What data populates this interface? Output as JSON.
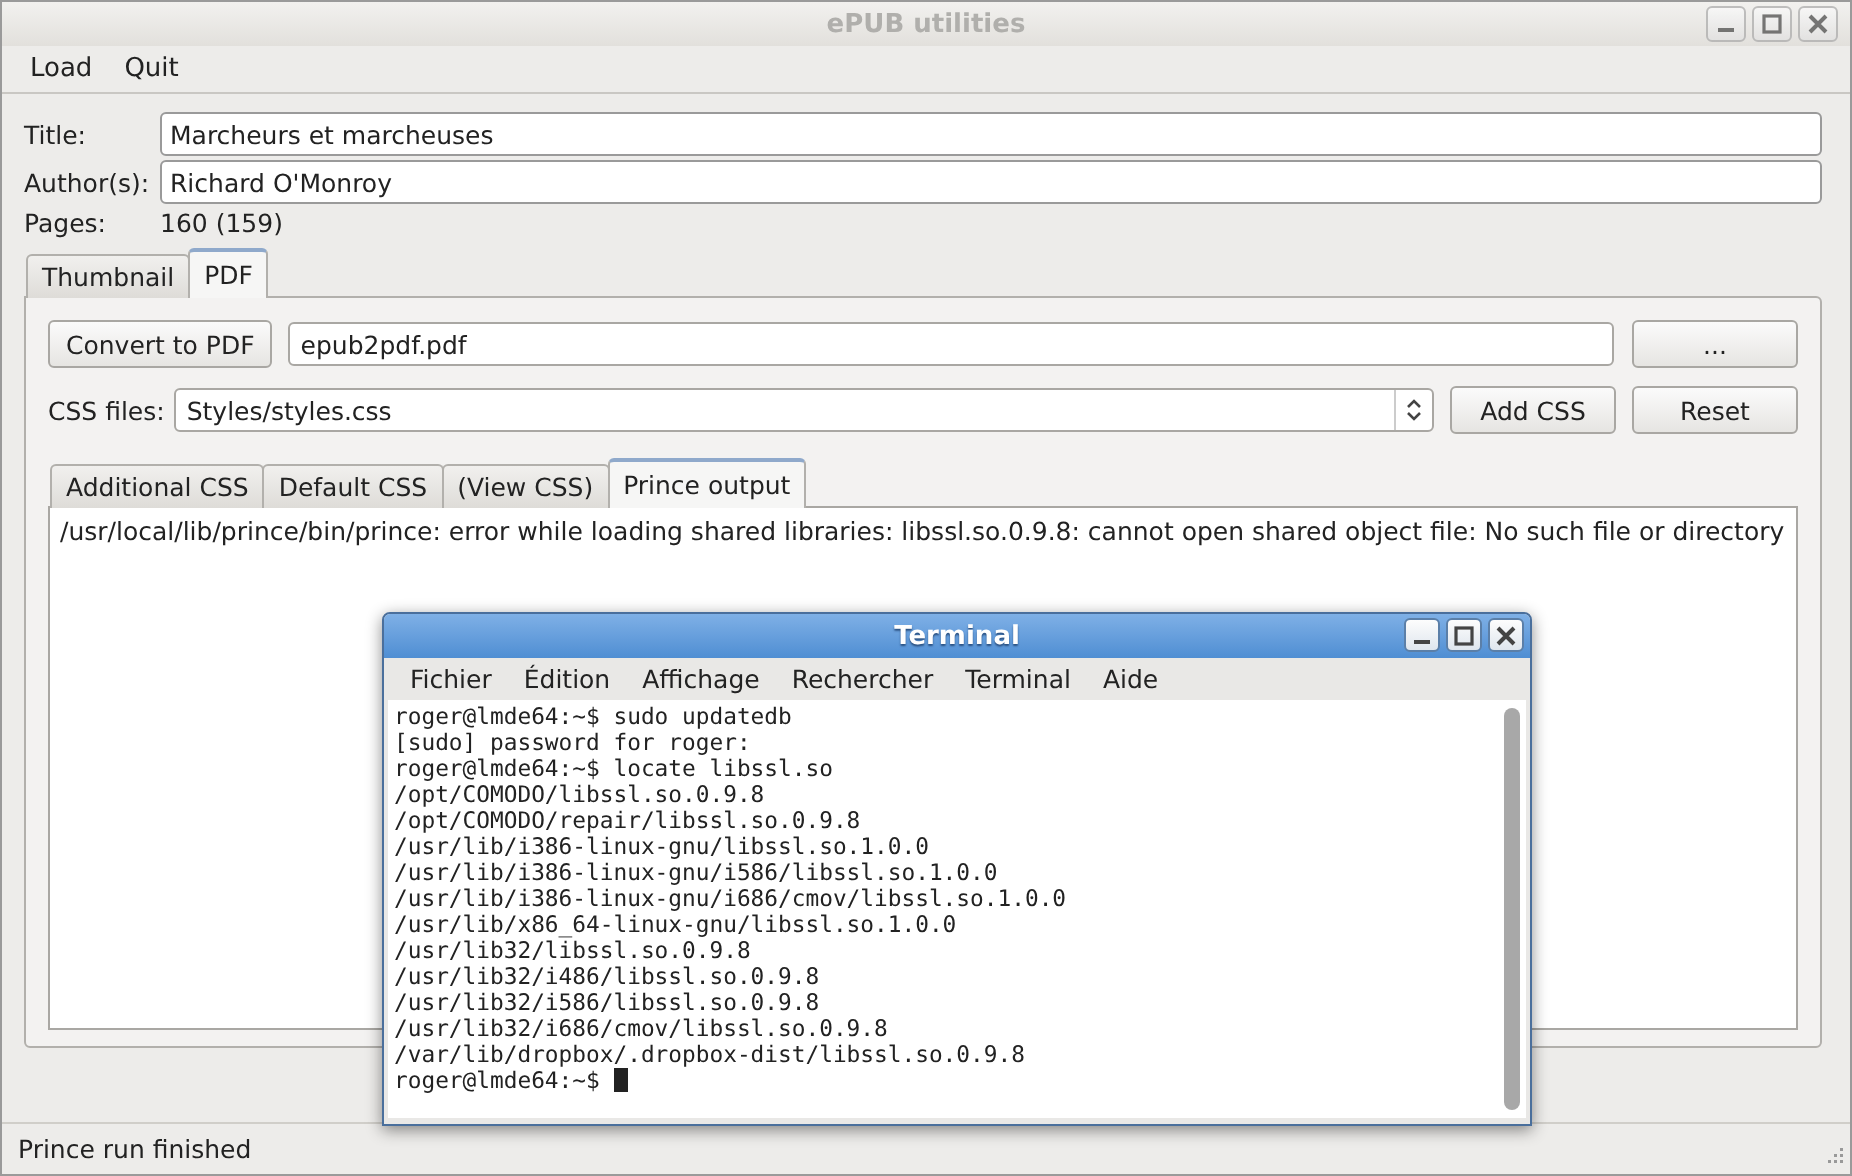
{
  "window": {
    "title": "ePUB utilities"
  },
  "menu": [
    "Load",
    "Quit"
  ],
  "fields": [
    {
      "label": "Title:",
      "value": "Marcheurs et marcheuses"
    },
    {
      "label": "Author(s):",
      "value": "Richard O'Monroy"
    }
  ],
  "pages": {
    "label": "Pages:",
    "value": "160 (159)"
  },
  "tabs": [
    {
      "label": "Thumbnail",
      "selected": false
    },
    {
      "label": "PDF",
      "selected": true
    }
  ],
  "pdf_panel": {
    "convert_button": "Convert to PDF",
    "output_file": "epub2pdf.pdf",
    "browse_button": "...",
    "css_label": "CSS files:",
    "css_file": "Styles/styles.css",
    "add_css_button": "Add CSS",
    "reset_button": "Reset",
    "subtabs": [
      {
        "label": "Additional CSS",
        "selected": false
      },
      {
        "label": "Default CSS",
        "selected": false
      },
      {
        "label": "(View CSS)",
        "selected": false
      },
      {
        "label": "Prince output",
        "selected": true
      }
    ],
    "output": "/usr/local/lib/prince/bin/prince: error while loading shared libraries: libssl.so.0.9.8: cannot open shared object file: No such file or directory"
  },
  "status_bar": "Prince run finished",
  "terminal": {
    "title": "Terminal",
    "menu": [
      "Fichier",
      "Édition",
      "Affichage",
      "Rechercher",
      "Terminal",
      "Aide"
    ],
    "lines": [
      "roger@lmde64:~$ sudo updatedb",
      "[sudo] password for roger:",
      "roger@lmde64:~$ locate libssl.so",
      "/opt/COMODO/libssl.so.0.9.8",
      "/opt/COMODO/repair/libssl.so.0.9.8",
      "/usr/lib/i386-linux-gnu/libssl.so.1.0.0",
      "/usr/lib/i386-linux-gnu/i586/libssl.so.1.0.0",
      "/usr/lib/i386-linux-gnu/i686/cmov/libssl.so.1.0.0",
      "/usr/lib/x86_64-linux-gnu/libssl.so.1.0.0",
      "/usr/lib32/libssl.so.0.9.8",
      "/usr/lib32/i486/libssl.so.0.9.8",
      "/usr/lib32/i586/libssl.so.0.9.8",
      "/usr/lib32/i686/cmov/libssl.so.0.9.8",
      "/var/lib/dropbox/.dropbox-dist/libssl.so.0.9.8",
      "roger@lmde64:~$"
    ],
    "cursor_visible": true
  }
}
